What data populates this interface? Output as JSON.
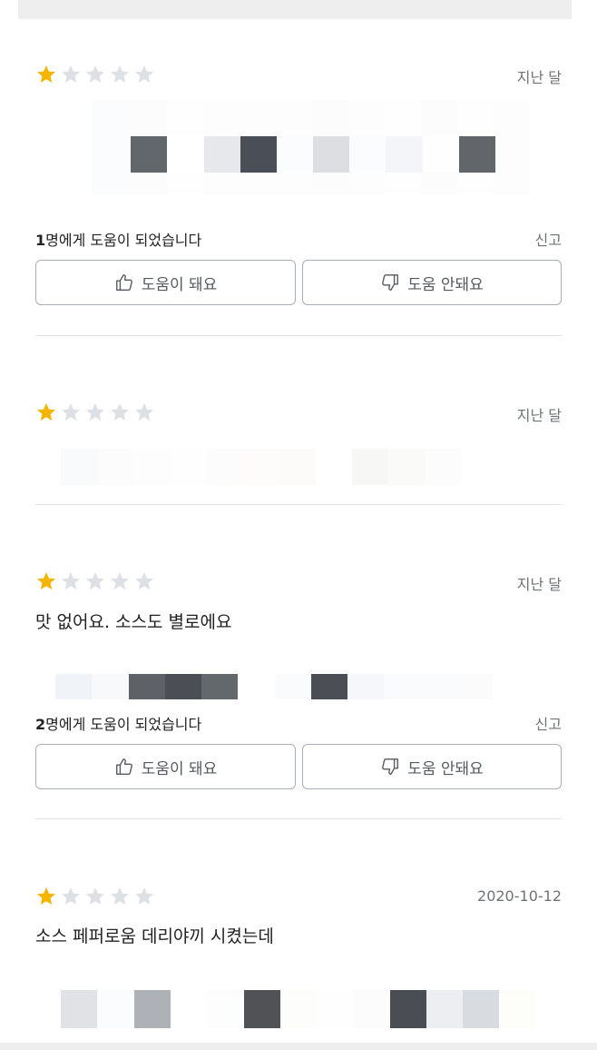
{
  "reviews": [
    {
      "rating": 1,
      "date": "지난 달",
      "helpful_count": "1",
      "helpful_suffix": "명에게 도움이 되었습니다",
      "report": "신고",
      "helpful_button": "도움이 돼요",
      "not_helpful_button": "도움 안돼요"
    },
    {
      "rating": 1,
      "date": "지난 달"
    },
    {
      "rating": 1,
      "date": "지난 달",
      "text": "맛 없어요. 소스도 별로에요",
      "helpful_count": "2",
      "helpful_suffix": "명에게 도움이 되었습니다",
      "report": "신고",
      "helpful_button": "도움이 돼요",
      "not_helpful_button": "도움 안돼요"
    },
    {
      "rating": 1,
      "date": "2020-10-12",
      "text": "소스 페퍼로움 데리야끼 시켰는데"
    }
  ],
  "colors": {
    "star_filled": "#f5b400",
    "star_empty": "#dde0e5",
    "button_border": "#a9aeb5",
    "divider": "#dfe1e4"
  },
  "icons": [
    "star-icon",
    "thumbs-up-icon",
    "thumbs-down-icon"
  ]
}
